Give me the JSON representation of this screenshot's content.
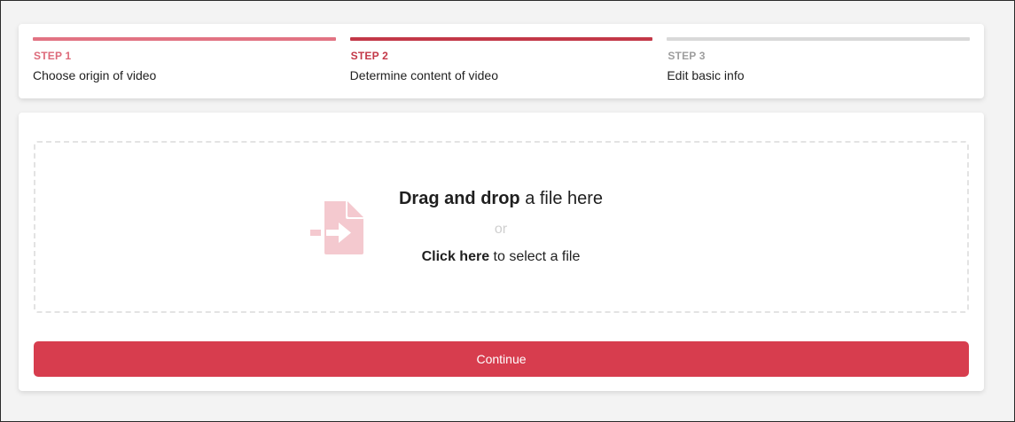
{
  "stepper": {
    "steps": [
      {
        "label": "STEP 1",
        "title": "Choose origin of video",
        "state": "done"
      },
      {
        "label": "STEP 2",
        "title": "Determine content of video",
        "state": "active"
      },
      {
        "label": "STEP 3",
        "title": "Edit basic info",
        "state": "pending"
      }
    ]
  },
  "dropzone": {
    "icon": "file-import-icon",
    "drag_strong": "Drag and drop",
    "drag_rest": " a file here",
    "or": "or",
    "click_strong": "Click here",
    "click_rest": " to select a file"
  },
  "actions": {
    "continue_label": "Continue"
  },
  "colors": {
    "accent": "#d73d4e",
    "step_done": "#e27383",
    "step_active": "#c33848",
    "step_pending": "#d9d9d9",
    "icon_tint": "#f4c9cf"
  }
}
